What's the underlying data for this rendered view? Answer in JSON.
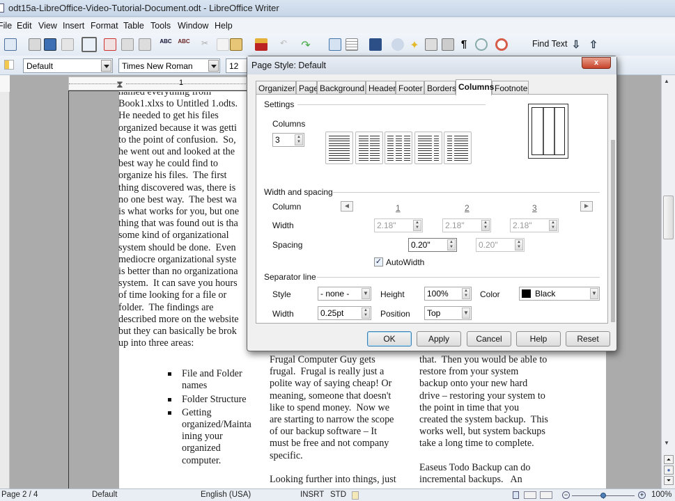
{
  "window": {
    "title": "odt15a-LibreOffice-Video-Tutorial-Document.odt - LibreOffice Writer"
  },
  "menu": [
    "File",
    "Edit",
    "View",
    "Insert",
    "Format",
    "Table",
    "Tools",
    "Window",
    "Help"
  ],
  "toolbar": {
    "icons": [
      "new-document-icon",
      "open-icon",
      "save-icon",
      "email-icon",
      "edit-mode-icon",
      "export-pdf-icon",
      "print-icon",
      "print-preview-icon",
      "spellcheck-icon",
      "autospellcheck-icon",
      "cut-icon",
      "copy-icon",
      "paste-icon",
      "clone-formatting-icon",
      "undo-icon",
      "redo-icon",
      "hyperlink-icon",
      "table-icon",
      "show-draw-functions-icon",
      "navigator-icon",
      "gallery-icon",
      "data-sources-icon",
      "nonprinting-characters-icon",
      "zoom-icon",
      "help-icon"
    ],
    "find_text_label": "Find Text"
  },
  "formatting": {
    "paragraph_style": "Default",
    "font_name": "Times New Roman",
    "font_size": "12"
  },
  "ruler": {
    "marks": [
      "1"
    ]
  },
  "document": {
    "col1_lines": [
      "named everything from",
      "Book1.xlxs to Untitled 1.odts.",
      "He needed to get his files",
      "organized because it was getti",
      "to the point of confusion.  So,",
      "he went out and looked at the",
      "best way he could find to",
      "organize his files.  The first",
      "thing discovered was, there is",
      "no one best way.  The best wa",
      "is what works for you, but one",
      "thing that was found out is tha",
      "some kind of organizational",
      "system should be done.  Even",
      "mediocre organizational syste",
      "is better than no organizationa",
      "system.  It can save you hours",
      "of time looking for a file or",
      "folder.  The findings are",
      "described more on the website",
      "but they can basically be brok",
      "up into three areas:"
    ],
    "bullets": [
      {
        "lines": [
          "File and Folder",
          "names"
        ]
      },
      {
        "lines": [
          "Folder Structure"
        ]
      },
      {
        "lines": [
          "Getting",
          "organized/Mainta",
          "ining your",
          "organized",
          "computer."
        ]
      }
    ],
    "col2_lines": [
      "Frugal Computer Guy gets",
      "frugal.  Frugal is really just a",
      "polite way of saying cheap! Or",
      "meaning, someone that doesn't",
      "like to spend money.  Now we",
      "are starting to narrow the scope",
      "of our backup software – It",
      "must be free and not company",
      "specific.",
      "",
      "Looking further into things, just"
    ],
    "col3_lines": [
      "that.  Then you would be able to",
      "restore from your system",
      "backup onto your new hard",
      "drive – restoring your system to",
      "the point in time that you",
      "created the system backup.  This",
      "works well, but system backups",
      "take a long time to complete.",
      "",
      "Easeus Todo Backup can do",
      "incremental backups.   An"
    ]
  },
  "dialog": {
    "title": "Page Style: Default",
    "close_label": "x",
    "tabs": [
      "Organizer",
      "Page",
      "Background",
      "Header",
      "Footer",
      "Borders",
      "Columns",
      "Footnote"
    ],
    "active_tab": "Columns",
    "settings": {
      "section_label": "Settings",
      "columns_label": "Columns",
      "columns_value": "3",
      "presets": [
        "1 column",
        "2 columns",
        "3 columns",
        "2 columns left-wide",
        "2 columns right-wide"
      ]
    },
    "width_spacing": {
      "section_label": "Width and spacing",
      "column_label": "Column",
      "column_numbers": [
        "1",
        "2",
        "3"
      ],
      "width_label": "Width",
      "widths": [
        "2.18\"",
        "2.18\"",
        "2.18\""
      ],
      "spacing_label": "Spacing",
      "spacings": [
        "0.20\"",
        "0.20\""
      ],
      "autowidth_label": "AutoWidth",
      "autowidth_checked": true
    },
    "separator": {
      "section_label": "Separator line",
      "style_label": "Style",
      "style_value": "- none -",
      "height_label": "Height",
      "height_value": "100%",
      "color_label": "Color",
      "color_value": "Black",
      "color_swatch": "#000000",
      "width_label": "Width",
      "width_value": "0.25pt",
      "position_label": "Position",
      "position_value": "Top"
    },
    "buttons": {
      "ok": "OK",
      "apply": "Apply",
      "cancel": "Cancel",
      "help": "Help",
      "reset": "Reset"
    }
  },
  "statusbar": {
    "page": "Page 2 / 4",
    "page_style": "Default",
    "language": "English (USA)",
    "insert_mode": "INSRT",
    "selection_mode": "STD",
    "zoom": "100%",
    "zoom_fraction": 0.5
  }
}
